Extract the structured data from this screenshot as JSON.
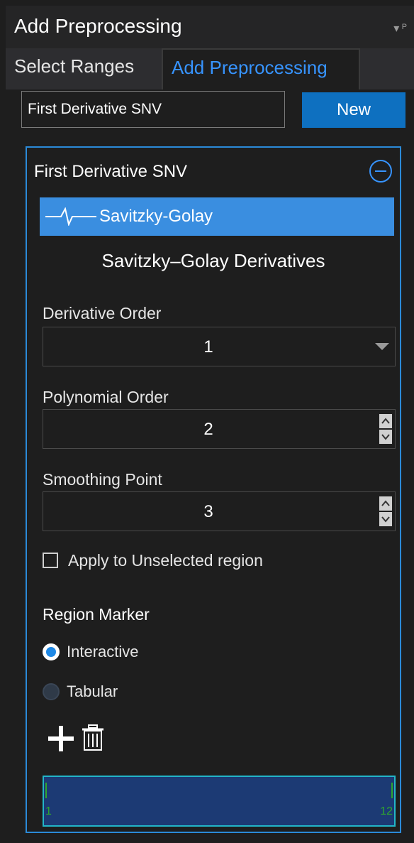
{
  "pane": {
    "title": "Add Preprocessing",
    "title_icons": [
      "dropdown-arrow-icon",
      "pin-icon"
    ]
  },
  "tabs": [
    {
      "label": "Select Ranges",
      "active": false
    },
    {
      "label": "Add Preprocessing",
      "active": true
    }
  ],
  "toolbar": {
    "name_value": "First Derivative SNV",
    "new_label": "New"
  },
  "card": {
    "title": "First Derivative SNV",
    "method_label": "Savitzky-Golay",
    "method_icon": "waveform-icon",
    "subtitle": "Savitzky–Golay Derivatives",
    "derivative_order": {
      "label": "Derivative Order",
      "value": "1"
    },
    "polynomial_order": {
      "label": "Polynomial Order",
      "value": "2"
    },
    "smoothing_point": {
      "label": "Smoothing Point",
      "value": "3"
    },
    "apply_unselected": {
      "label": "Apply to Unselected region",
      "checked": false
    },
    "region_marker": {
      "heading": "Region Marker",
      "options": [
        {
          "label": "Interactive",
          "selected": true
        },
        {
          "label": "Tabular",
          "selected": false
        }
      ]
    },
    "tools": [
      "plus-icon",
      "trash-icon"
    ],
    "range": {
      "start": "1",
      "end": "12"
    }
  },
  "colors": {
    "accent": "#3a8ee0",
    "tab_active": "#3794ff",
    "new_button": "#0e70c0",
    "card_border": "#2b8ad8",
    "range_fill": "#1c3a74",
    "range_marker": "#2fa62f"
  }
}
